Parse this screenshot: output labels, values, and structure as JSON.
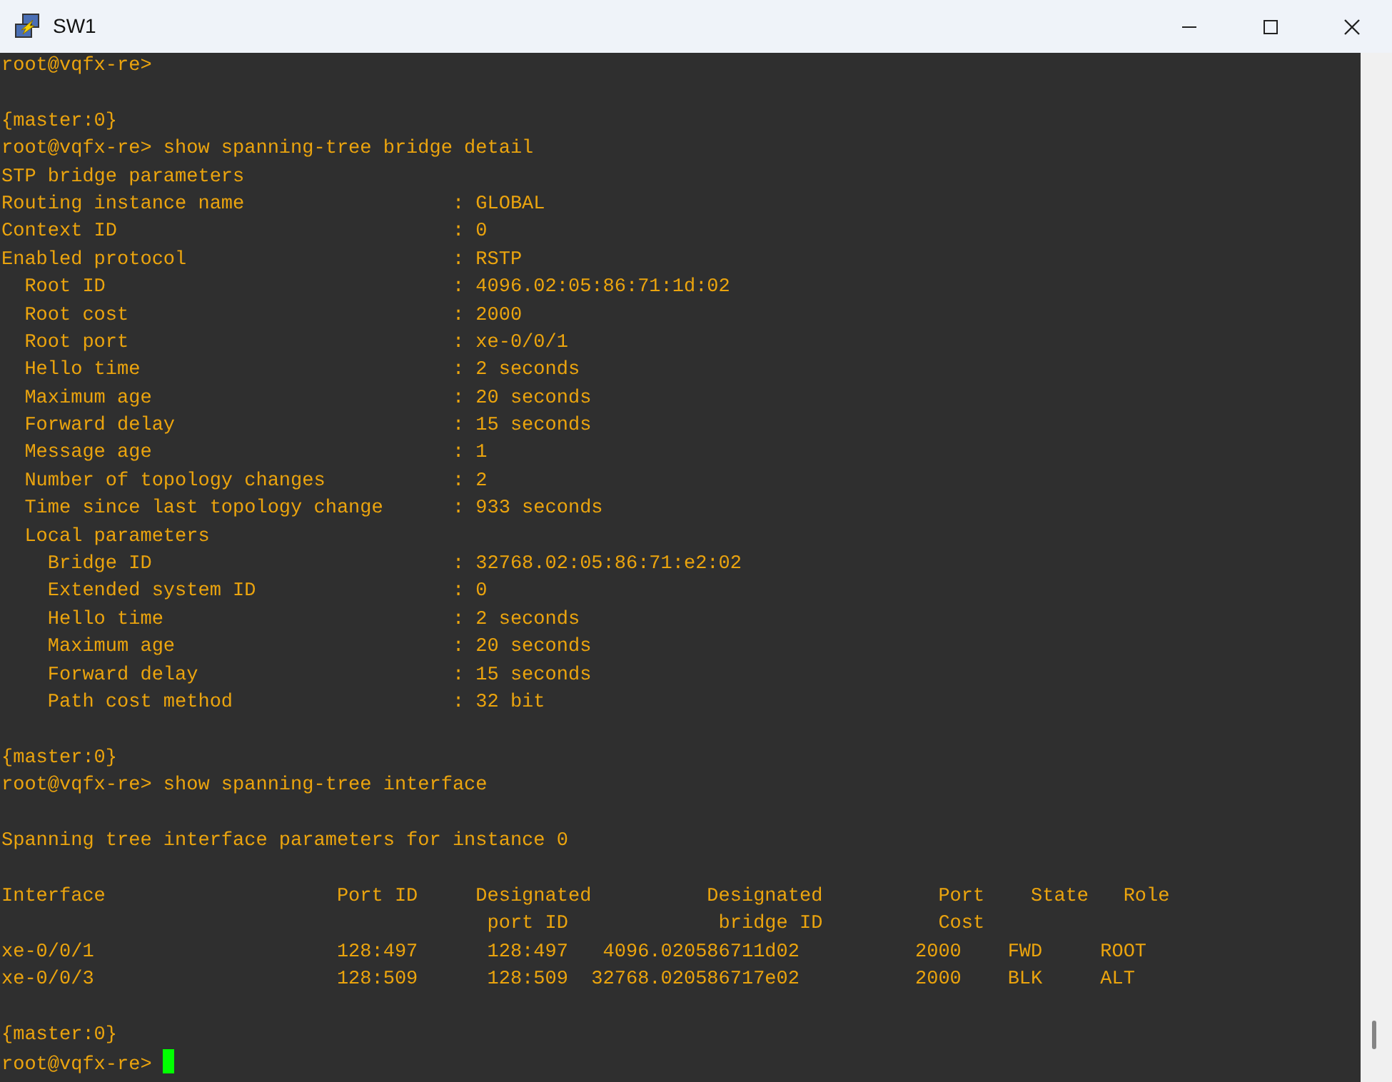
{
  "window": {
    "title": "SW1"
  },
  "terminal": {
    "lines": [
      {
        "text": "root@vqfx-re>"
      },
      {
        "text": "{master:0}",
        "blank_before": true
      },
      {
        "text": "root@vqfx-re> show spanning-tree bridge detail"
      },
      {
        "text": "STP bridge parameters"
      },
      {
        "text": "Routing instance name                  : GLOBAL"
      },
      {
        "text": "Context ID                             : 0"
      },
      {
        "text": "Enabled protocol                       : RSTP"
      },
      {
        "text": "  Root ID                              : 4096.02:05:86:71:1d:02"
      },
      {
        "text": "  Root cost                            : 2000"
      },
      {
        "text": "  Root port                            : xe-0/0/1"
      },
      {
        "text": "  Hello time                           : 2 seconds"
      },
      {
        "text": "  Maximum age                          : 20 seconds"
      },
      {
        "text": "  Forward delay                        : 15 seconds"
      },
      {
        "text": "  Message age                          : 1"
      },
      {
        "text": "  Number of topology changes           : 2"
      },
      {
        "text": "  Time since last topology change      : 933 seconds"
      },
      {
        "text": "  Local parameters"
      },
      {
        "text": "    Bridge ID                          : 32768.02:05:86:71:e2:02"
      },
      {
        "text": "    Extended system ID                 : 0"
      },
      {
        "text": "    Hello time                         : 2 seconds"
      },
      {
        "text": "    Maximum age                        : 20 seconds"
      },
      {
        "text": "    Forward delay                      : 15 seconds"
      },
      {
        "text": "    Path cost method                   : 32 bit"
      },
      {
        "text": "{master:0}",
        "blank_before": true
      },
      {
        "text": "root@vqfx-re> show spanning-tree interface"
      },
      {
        "text": "Spanning tree interface parameters for instance 0",
        "blank_before": true
      },
      {
        "text": "Interface                    Port ID     Designated          Designated          Port    State   Role",
        "blank_before": true
      },
      {
        "text": "                                          port ID             bridge ID          Cost"
      },
      {
        "text": "xe-0/0/1                     128:497      128:497   4096.020586711d02          2000    FWD     ROOT"
      },
      {
        "text": "xe-0/0/3                     128:509      128:509  32768.020586717e02          2000    BLK     ALT"
      },
      {
        "text": "{master:0}",
        "blank_before": true
      },
      {
        "text": "root@vqfx-re> ",
        "cursor": true
      }
    ]
  }
}
